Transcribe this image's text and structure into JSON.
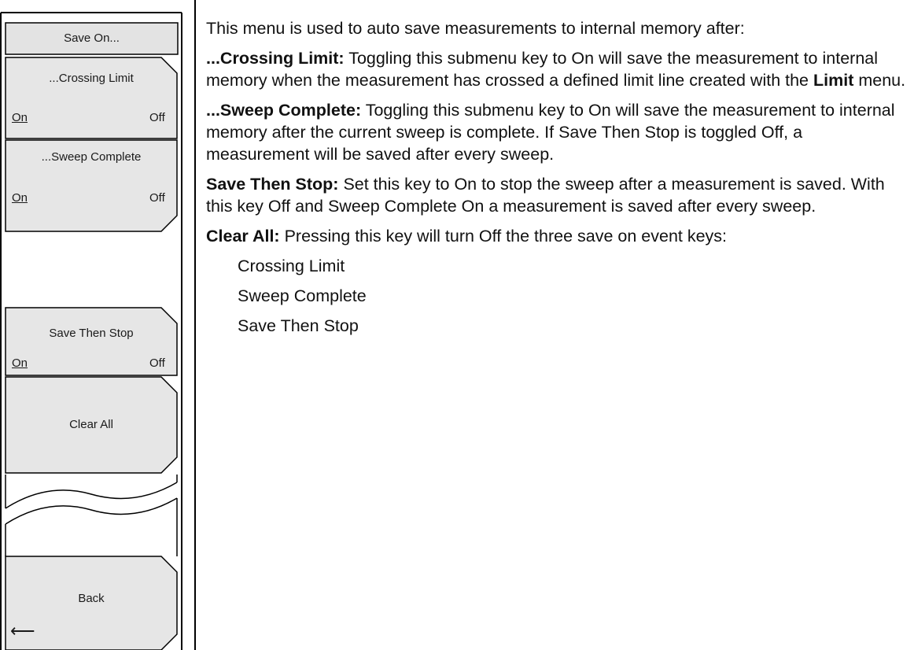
{
  "menu": {
    "title": "Save On...",
    "keys": [
      {
        "label": "...Crossing Limit",
        "on": "On",
        "off": "Off"
      },
      {
        "label": "...Sweep Complete",
        "on": "On",
        "off": "Off"
      },
      {
        "label": "Save Then Stop",
        "on": "On",
        "off": "Off"
      },
      {
        "label": "Clear All"
      },
      {
        "label": "Back",
        "arrow": "⟵"
      }
    ]
  },
  "description": {
    "intro": "This menu is used to auto save measurements to internal memory after:",
    "items": [
      {
        "term": "...Crossing Limit:",
        "text_a": "Toggling this submenu key to On will save the measurement to internal memory when the measurement has crossed a defined limit line created with the",
        "term2": "Limit",
        "text_b": "menu."
      },
      {
        "term": "...Sweep Complete:",
        "text": "Toggling this submenu key to On will save the measurement to internal memory after the current sweep is complete. If Save Then Stop is toggled Off, a measurement will be saved after every sweep."
      },
      {
        "term": "Save Then Stop:",
        "text": "Set this key to On to stop the sweep after a measurement is saved. With this key Off and Sweep Complete On a measurement is saved after every sweep."
      },
      {
        "term": "Clear All:",
        "text": "Pressing this key will turn Off the three save on event keys:"
      }
    ],
    "list": [
      "Crossing Limit",
      "Sweep Complete",
      "Save Then Stop"
    ]
  }
}
